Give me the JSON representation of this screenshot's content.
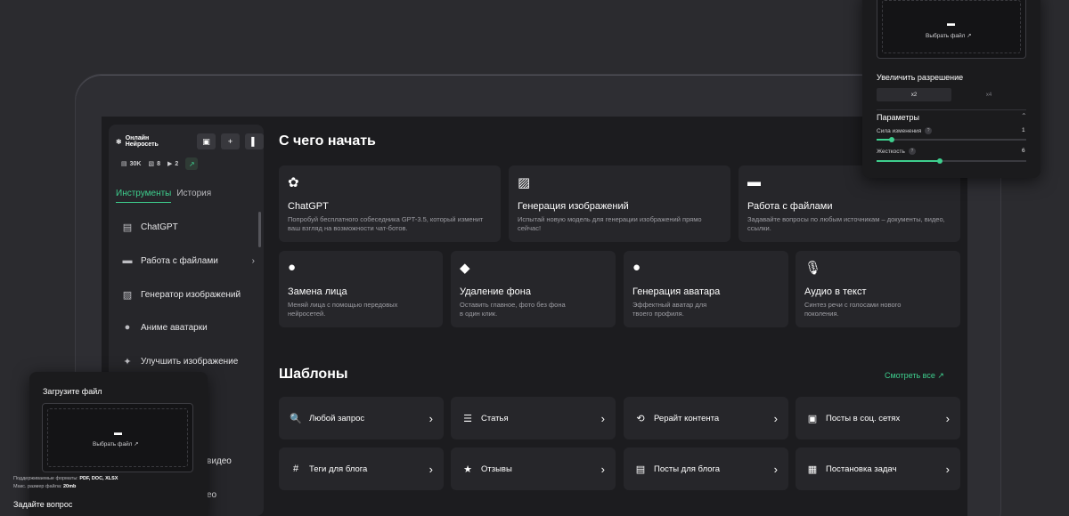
{
  "sidebar": {
    "brand": "Онлайн Нейросеть",
    "stats": [
      {
        "icon": "chat-icon",
        "value": "30K"
      },
      {
        "icon": "image-icon",
        "value": "8"
      },
      {
        "icon": "video-icon",
        "value": "2"
      }
    ],
    "tabs": [
      "Инструменты",
      "История"
    ],
    "items": [
      {
        "label": "ChatGPT",
        "icon": "chat-bubble-icon"
      },
      {
        "label": "Работа с файлами",
        "icon": "folder-icon",
        "chevron": "›"
      },
      {
        "label": "Генератор изображений",
        "icon": "image-icon"
      },
      {
        "label": "Аниме аватарки",
        "icon": "person-icon"
      },
      {
        "label": "Улучшить изображение",
        "icon": "sparkle-icon"
      },
      {
        "label": "видео",
        "icon": ""
      },
      {
        "label": "ео",
        "icon": ""
      }
    ]
  },
  "main": {
    "heading": "С чего начать",
    "cards": [
      {
        "title": "ChatGPT",
        "desc": "Попробуй бесплатного собеседника GPT-3.5, который изменит ваш взгляд на возможности чат-ботов.",
        "icon": "openai-icon"
      },
      {
        "title": "Генерация изображений",
        "desc": "Испытай новую модель для генерации изображений прямо сейчас!",
        "icon": "image-icon"
      },
      {
        "title": "Работа с файлами",
        "desc": "Задавайте вопросы по любым источникам – документы, видео, ссылки.",
        "icon": "folder-icon"
      },
      {
        "title": "Замена лица",
        "desc": "Меняй лица с помощью передовых нейросетей.",
        "icon": "face-icon"
      },
      {
        "title": "Удаление фона",
        "desc": "Оставить главное, фото без фона в один клик.",
        "icon": "eraser-icon"
      },
      {
        "title": "Генерация аватара",
        "desc": "Эффектный аватар для твоего профиля.",
        "icon": "avatar-icon"
      },
      {
        "title": "Аудио в текст",
        "desc": "Синтез речи с голосами нового поколения.",
        "icon": "mic-icon"
      }
    ],
    "templates_heading": "Шаблоны",
    "see_all": "Смотреть все ↗",
    "templates": [
      {
        "label": "Любой запрос",
        "icon": "search-icon"
      },
      {
        "label": "Статья",
        "icon": "article-icon"
      },
      {
        "label": "Рерайт контента",
        "icon": "rewrite-icon"
      },
      {
        "label": "Посты в соц. сетях",
        "icon": "social-icon"
      },
      {
        "label": "Теги для блога",
        "icon": "hash-icon"
      },
      {
        "label": "Отзывы",
        "icon": "star-icon"
      },
      {
        "label": "Посты для блога",
        "icon": "blog-icon"
      },
      {
        "label": "Постановка задач",
        "icon": "task-icon"
      }
    ]
  },
  "upload_panel": {
    "title": "Загрузите файл",
    "choose_file": "Выбрать файл ↗",
    "formats_label": "Поддерживаемые форматы:",
    "formats_value": "PDF, DOC, XLSX",
    "max_size_label": "Макс. размер файла:",
    "max_size_value": "20mb",
    "ask_label": "Задайте вопрос"
  },
  "settings_panel": {
    "choose_file": "Выбрать файл ↗",
    "upscale_label": "Увеличить разрешение",
    "upscale_options": [
      "x2",
      "x4"
    ],
    "upscale_selected": "x2",
    "params_label": "Параметры",
    "params": [
      {
        "name": "Сила изменения",
        "value": "1",
        "level": 0.1
      },
      {
        "name": "Жесткость",
        "value": "6",
        "level": 0.42
      }
    ]
  },
  "colors": {
    "accent": "#3ecf8e",
    "background": "#1c1c1f",
    "card": "#26262a"
  }
}
